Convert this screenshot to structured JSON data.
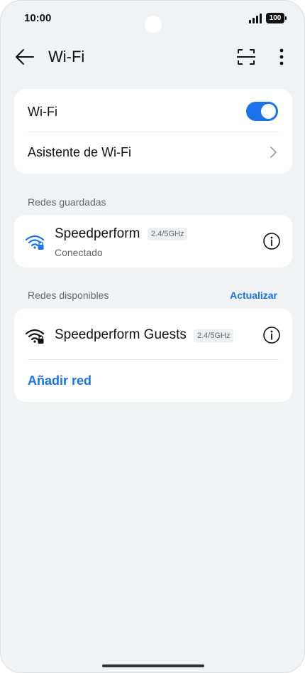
{
  "status_bar": {
    "time": "10:00",
    "battery": "100"
  },
  "header": {
    "title": "Wi-Fi"
  },
  "wifi_card": {
    "toggle_label": "Wi-Fi",
    "toggle_on": true,
    "assistant_label": "Asistente de Wi-Fi"
  },
  "saved_networks": {
    "section_label": "Redes guardadas",
    "items": [
      {
        "name": "Speedperform",
        "band": "2.4/5GHz",
        "status": "Conectado"
      }
    ]
  },
  "available_networks": {
    "section_label": "Redes disponibles",
    "refresh_label": "Actualizar",
    "items": [
      {
        "name": "Speedperform Guests",
        "band": "2.4/5GHz"
      }
    ],
    "add_network_label": "Añadir red"
  },
  "colors": {
    "accent": "#1a73e8",
    "background": "#f1f2f4",
    "card": "#ffffff"
  },
  "icons": [
    "back-arrow-icon",
    "scan-icon",
    "more-vert-icon",
    "chevron-right-icon",
    "wifi-lock-icon",
    "info-icon"
  ]
}
